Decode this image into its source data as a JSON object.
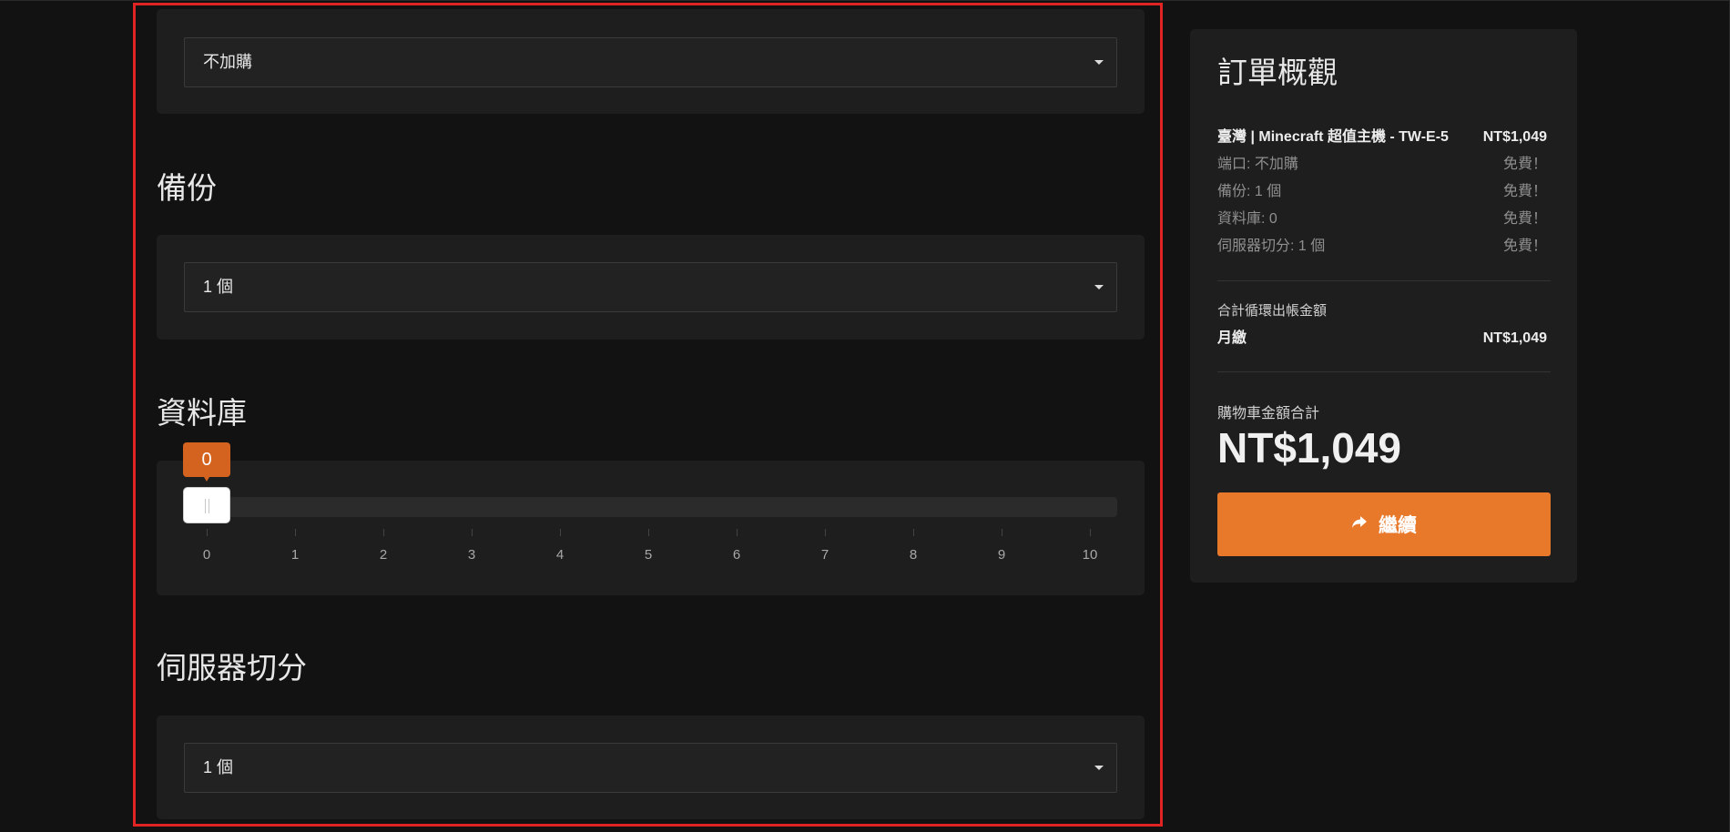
{
  "colors": {
    "background": "#121212",
    "card": "#1e1e1e",
    "accent": "#e8782a",
    "tooltip": "#d4631f",
    "highlight": "#e02424"
  },
  "port_section": {
    "selected": "不加購"
  },
  "backup_section": {
    "title": "備份",
    "selected": "1 個"
  },
  "database_section": {
    "title": "資料庫",
    "slider": {
      "value": "0",
      "min": 0,
      "max": 10,
      "ticks": [
        "0",
        "1",
        "2",
        "3",
        "4",
        "5",
        "6",
        "7",
        "8",
        "9",
        "10"
      ]
    }
  },
  "split_section": {
    "title": "伺服器切分",
    "selected": "1 個"
  },
  "summary": {
    "title": "訂單概觀",
    "product": {
      "name": "臺灣 | Minecraft 超值主機 - TW-E-5",
      "price": "NT$1,049"
    },
    "items": [
      {
        "label": "端口: 不加購",
        "price": "免費！"
      },
      {
        "label": "備份: 1 個",
        "price": "免費！"
      },
      {
        "label": "資料庫: 0",
        "price": "免費！"
      },
      {
        "label": "伺服器切分: 1 個",
        "price": "免費！"
      }
    ],
    "recurring_title": "合計循環出帳金額",
    "recurring": {
      "label": "月繳",
      "price": "NT$1,049"
    },
    "cart_total_label": "購物車金額合計",
    "cart_total": "NT$1,049",
    "continue_icon": "share-arrow-icon",
    "continue_label": "繼續"
  }
}
